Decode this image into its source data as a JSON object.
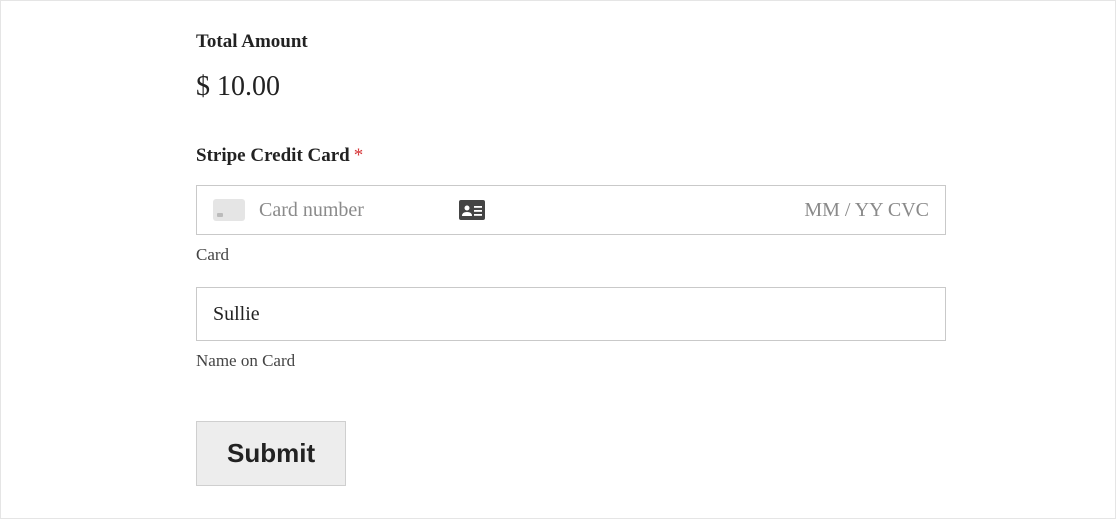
{
  "total": {
    "label": "Total Amount",
    "value": "$ 10.00"
  },
  "card_section": {
    "label": "Stripe Credit Card",
    "required_mark": "*",
    "card_number_placeholder": "Card number",
    "expiry_cvc_placeholder": "MM / YY  CVC",
    "sublabel": "Card"
  },
  "name_section": {
    "value": "Sullie",
    "sublabel": "Name on Card"
  },
  "submit": {
    "label": "Submit"
  },
  "icons": {
    "card": "card-icon",
    "id_card": "id-card-icon"
  }
}
